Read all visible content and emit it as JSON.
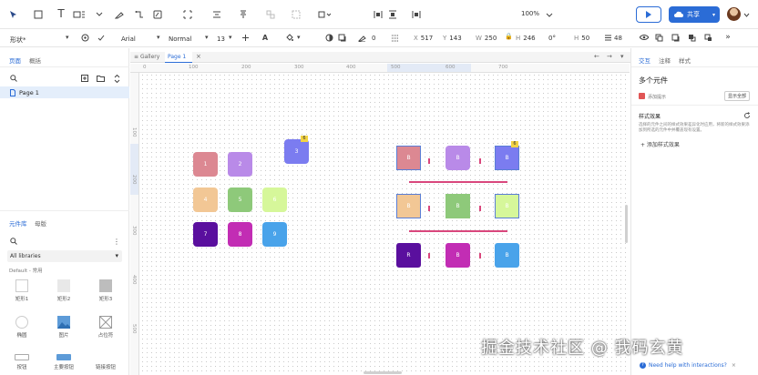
{
  "toolbar": {
    "zoom": "100%",
    "share_label": "共享",
    "play_icon": "play-icon",
    "cloud_icon": "cloud-icon"
  },
  "props": {
    "layer_type": "形状*",
    "font_family": "Arial",
    "font_style": "Normal",
    "font_size": "13",
    "stroke_value": "0",
    "x_label": "X",
    "x_value": "517",
    "y_label": "Y",
    "y_value": "143",
    "w_label": "W",
    "w_value": "250",
    "h_label": "H",
    "h_value": "246",
    "rotate": "0°",
    "radius_label": "H",
    "radius_value": "50",
    "z_value": "48"
  },
  "left_panel": {
    "tab_pages": "页面",
    "tab_outline": "概括",
    "page_item": "Page 1",
    "lib_tab_components": "元件库",
    "lib_tab_help": "母版",
    "lib_select": "All libraries",
    "lib_group": "Default - 常用",
    "lib_items": [
      "矩形1",
      "矩形2",
      "矩形3",
      "椭圆",
      "图片",
      "占位符",
      "按钮",
      "主要按钮",
      "链接按钮"
    ]
  },
  "canvas": {
    "tab_gallery": "Gallery",
    "tab_page": "Page 1",
    "ruler_h": [
      "0",
      "100",
      "200",
      "300",
      "400",
      "500",
      "600",
      "700"
    ],
    "ruler_v": [
      "100",
      "200",
      "300",
      "400",
      "500"
    ],
    "left_tiles": [
      {
        "label": "1",
        "color": "#dc8892"
      },
      {
        "label": "2",
        "color": "#b98ae8"
      },
      {
        "label": "3",
        "color": "#7b7cf0"
      },
      {
        "label": "4",
        "color": "#f2c795"
      },
      {
        "label": "5",
        "color": "#8ec97a"
      },
      {
        "label": "6",
        "color": "#d6f79a"
      },
      {
        "label": "7",
        "color": "#5a0f9e"
      },
      {
        "label": "8",
        "color": "#c22db4"
      },
      {
        "label": "9",
        "color": "#49a3ea"
      }
    ],
    "badge_text": "6",
    "right_tiles": [
      {
        "label": "B",
        "color": "#dc8892"
      },
      {
        "label": "B",
        "color": "#b98ae8"
      },
      {
        "label": "B",
        "color": "#7b7cf0"
      },
      {
        "label": "B",
        "color": "#f2c795"
      },
      {
        "label": "B",
        "color": "#8ec97a"
      },
      {
        "label": "B",
        "color": "#d6f79a"
      },
      {
        "label": "R",
        "color": "#5a0f9e"
      },
      {
        "label": "B",
        "color": "#c22db4"
      },
      {
        "label": "B",
        "color": "#49a3ea"
      }
    ],
    "help_text": "Need help with interactions?",
    "watermark": "掘金技术社区 @ 我码玄黄"
  },
  "right_panel": {
    "tab_style": "交互",
    "tab_notes": "注释",
    "tab_styles": "样式",
    "heading": "多个元件",
    "hint_label": "添加提示",
    "hint_button": "显示全部",
    "section_title": "样式效果",
    "desc": "选择的元件之间的样式效果差异化时应用，将新的样式效果添加到所选的元件中并覆盖现有设置。",
    "add_effect": "+ 添加样式效果"
  }
}
